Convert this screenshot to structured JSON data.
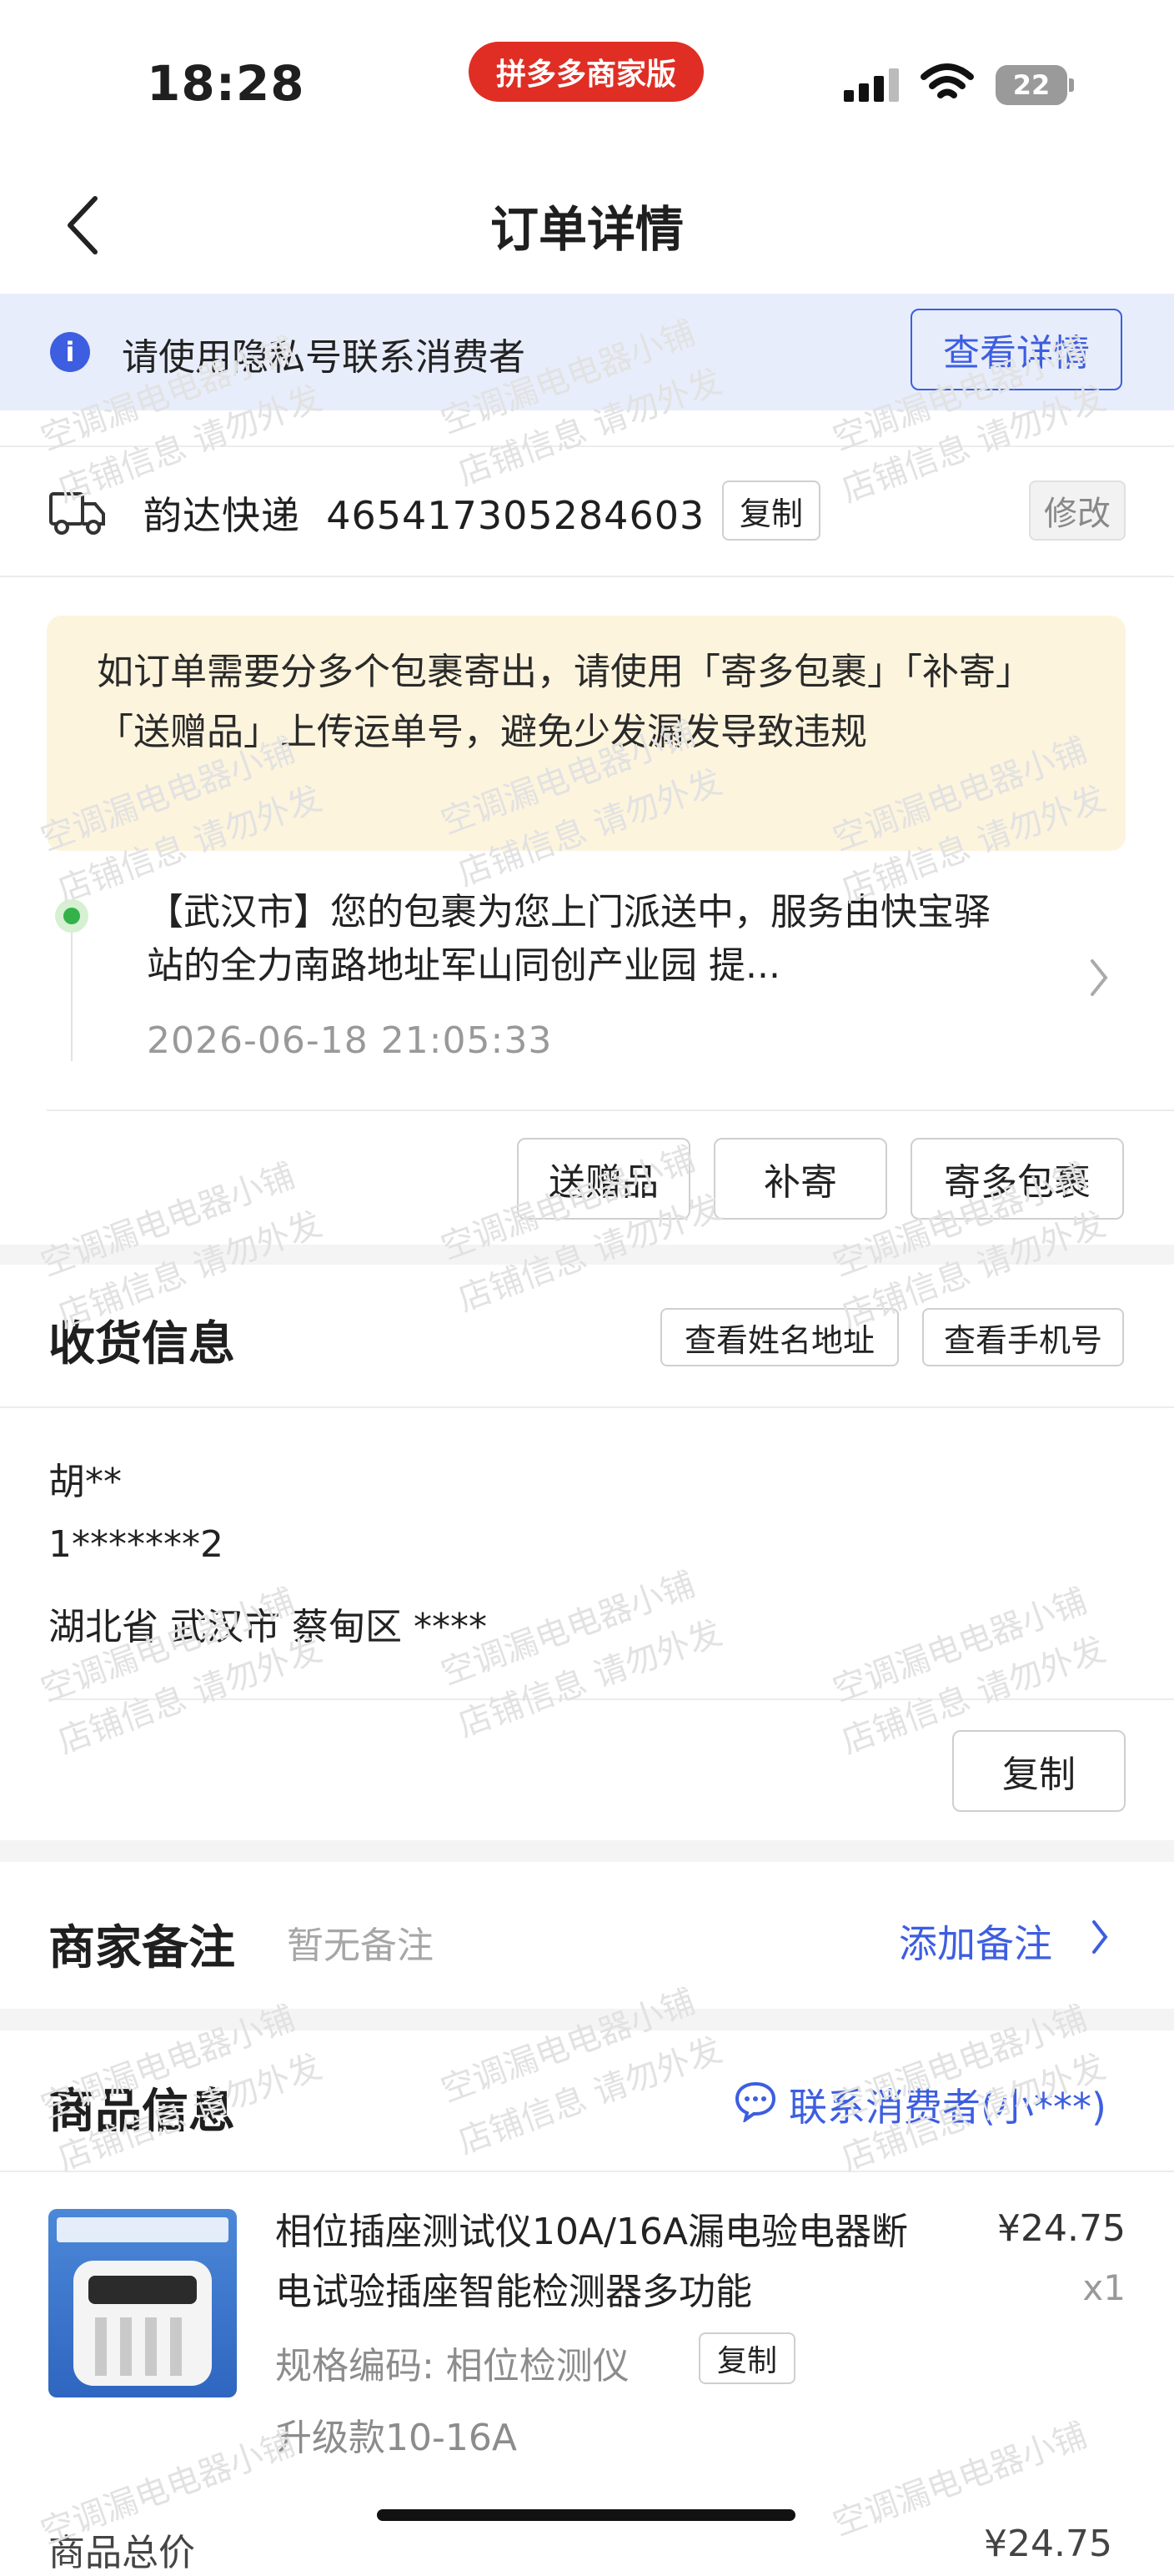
{
  "status_bar": {
    "time": "18:28",
    "app_badge": "拼多多商家版",
    "battery": "22"
  },
  "header": {
    "title": "订单详情"
  },
  "privacy_banner": {
    "text": "请使用隐私号联系消费者",
    "button": "查看详情"
  },
  "shipping": {
    "courier_line": "韵达快递  465417305284603",
    "copy_label": "复制",
    "edit_label": "修改",
    "notice": "如订单需要分多个包裹寄出，请使用「寄多包裹」「补寄」「送赠品」上传运单号，避免少发漏发导致违规",
    "tracking": {
      "text": "【武汉市】您的包裹为您上门派送中，服务由快宝驿站的全力南路地址军山同创产业园 提...",
      "time": "2026-06-18 21:05:33"
    },
    "actions": [
      "送赠品",
      "补寄",
      "寄多包裹"
    ]
  },
  "receiver": {
    "title": "收货信息",
    "view_name_btn": "查看姓名地址",
    "view_phone_btn": "查看手机号",
    "name": "胡**",
    "phone": "1*******2",
    "address": "湖北省 武汉市 蔡甸区 ****",
    "copy_label": "复制"
  },
  "merchant_note": {
    "title": "商家备注",
    "placeholder": "暂无备注",
    "add_label": "添加备注"
  },
  "product": {
    "title": "商品信息",
    "contact_label": "联系消费者(小***)",
    "name": "相位插座测试仪10A/16A漏电验电器断电试验插座智能检测器多功能",
    "price": "¥24.75",
    "qty": "x1",
    "spec": "规格编码: 相位检测仪",
    "spec_copy": "复制",
    "variant": "升级款10-16A"
  },
  "partial_row": {
    "label": "商品总价",
    "value": "¥24.75"
  },
  "watermark": {
    "line1": "空调漏电电器小铺",
    "line2": "店铺信息 请勿外发"
  }
}
